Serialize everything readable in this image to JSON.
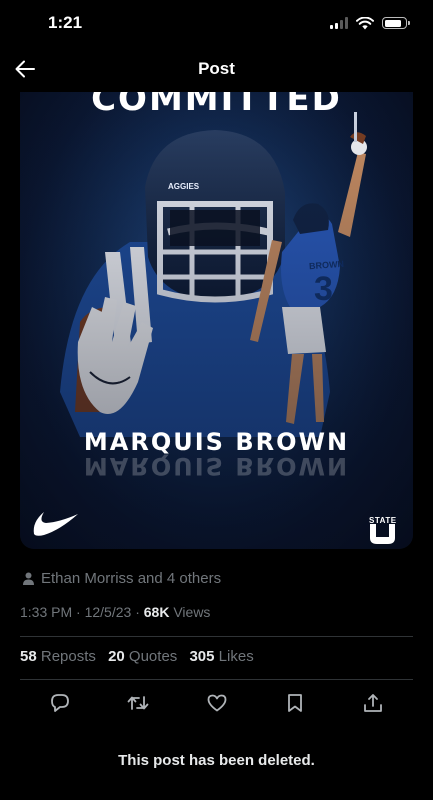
{
  "status_bar": {
    "time": "1:21"
  },
  "header": {
    "title": "Post"
  },
  "media": {
    "headline": "COMMITTED",
    "player_name": "MARQUIS BROWN",
    "helmet_text": "AGGIES",
    "jersey_name": "BROWN",
    "jersey_number": "3",
    "logo_text": "STATE"
  },
  "post": {
    "reposted_by": "Ethan Morriss and 4 others",
    "time": "1:33 PM",
    "date": "12/5/23",
    "views_count": "68K",
    "views_label": "Views",
    "reposts_count": "58",
    "reposts_label": "Reposts",
    "quotes_count": "20",
    "quotes_label": "Quotes",
    "likes_count": "305",
    "likes_label": "Likes",
    "deleted_message": "This post has been deleted."
  },
  "icons": {
    "back": "arrow-left-icon",
    "reply": "reply-icon",
    "repost": "repost-icon",
    "like": "heart-icon",
    "bookmark": "bookmark-icon",
    "share": "share-icon",
    "brand": "nike-swoosh-icon",
    "team_logo": "usu-logo-icon"
  }
}
